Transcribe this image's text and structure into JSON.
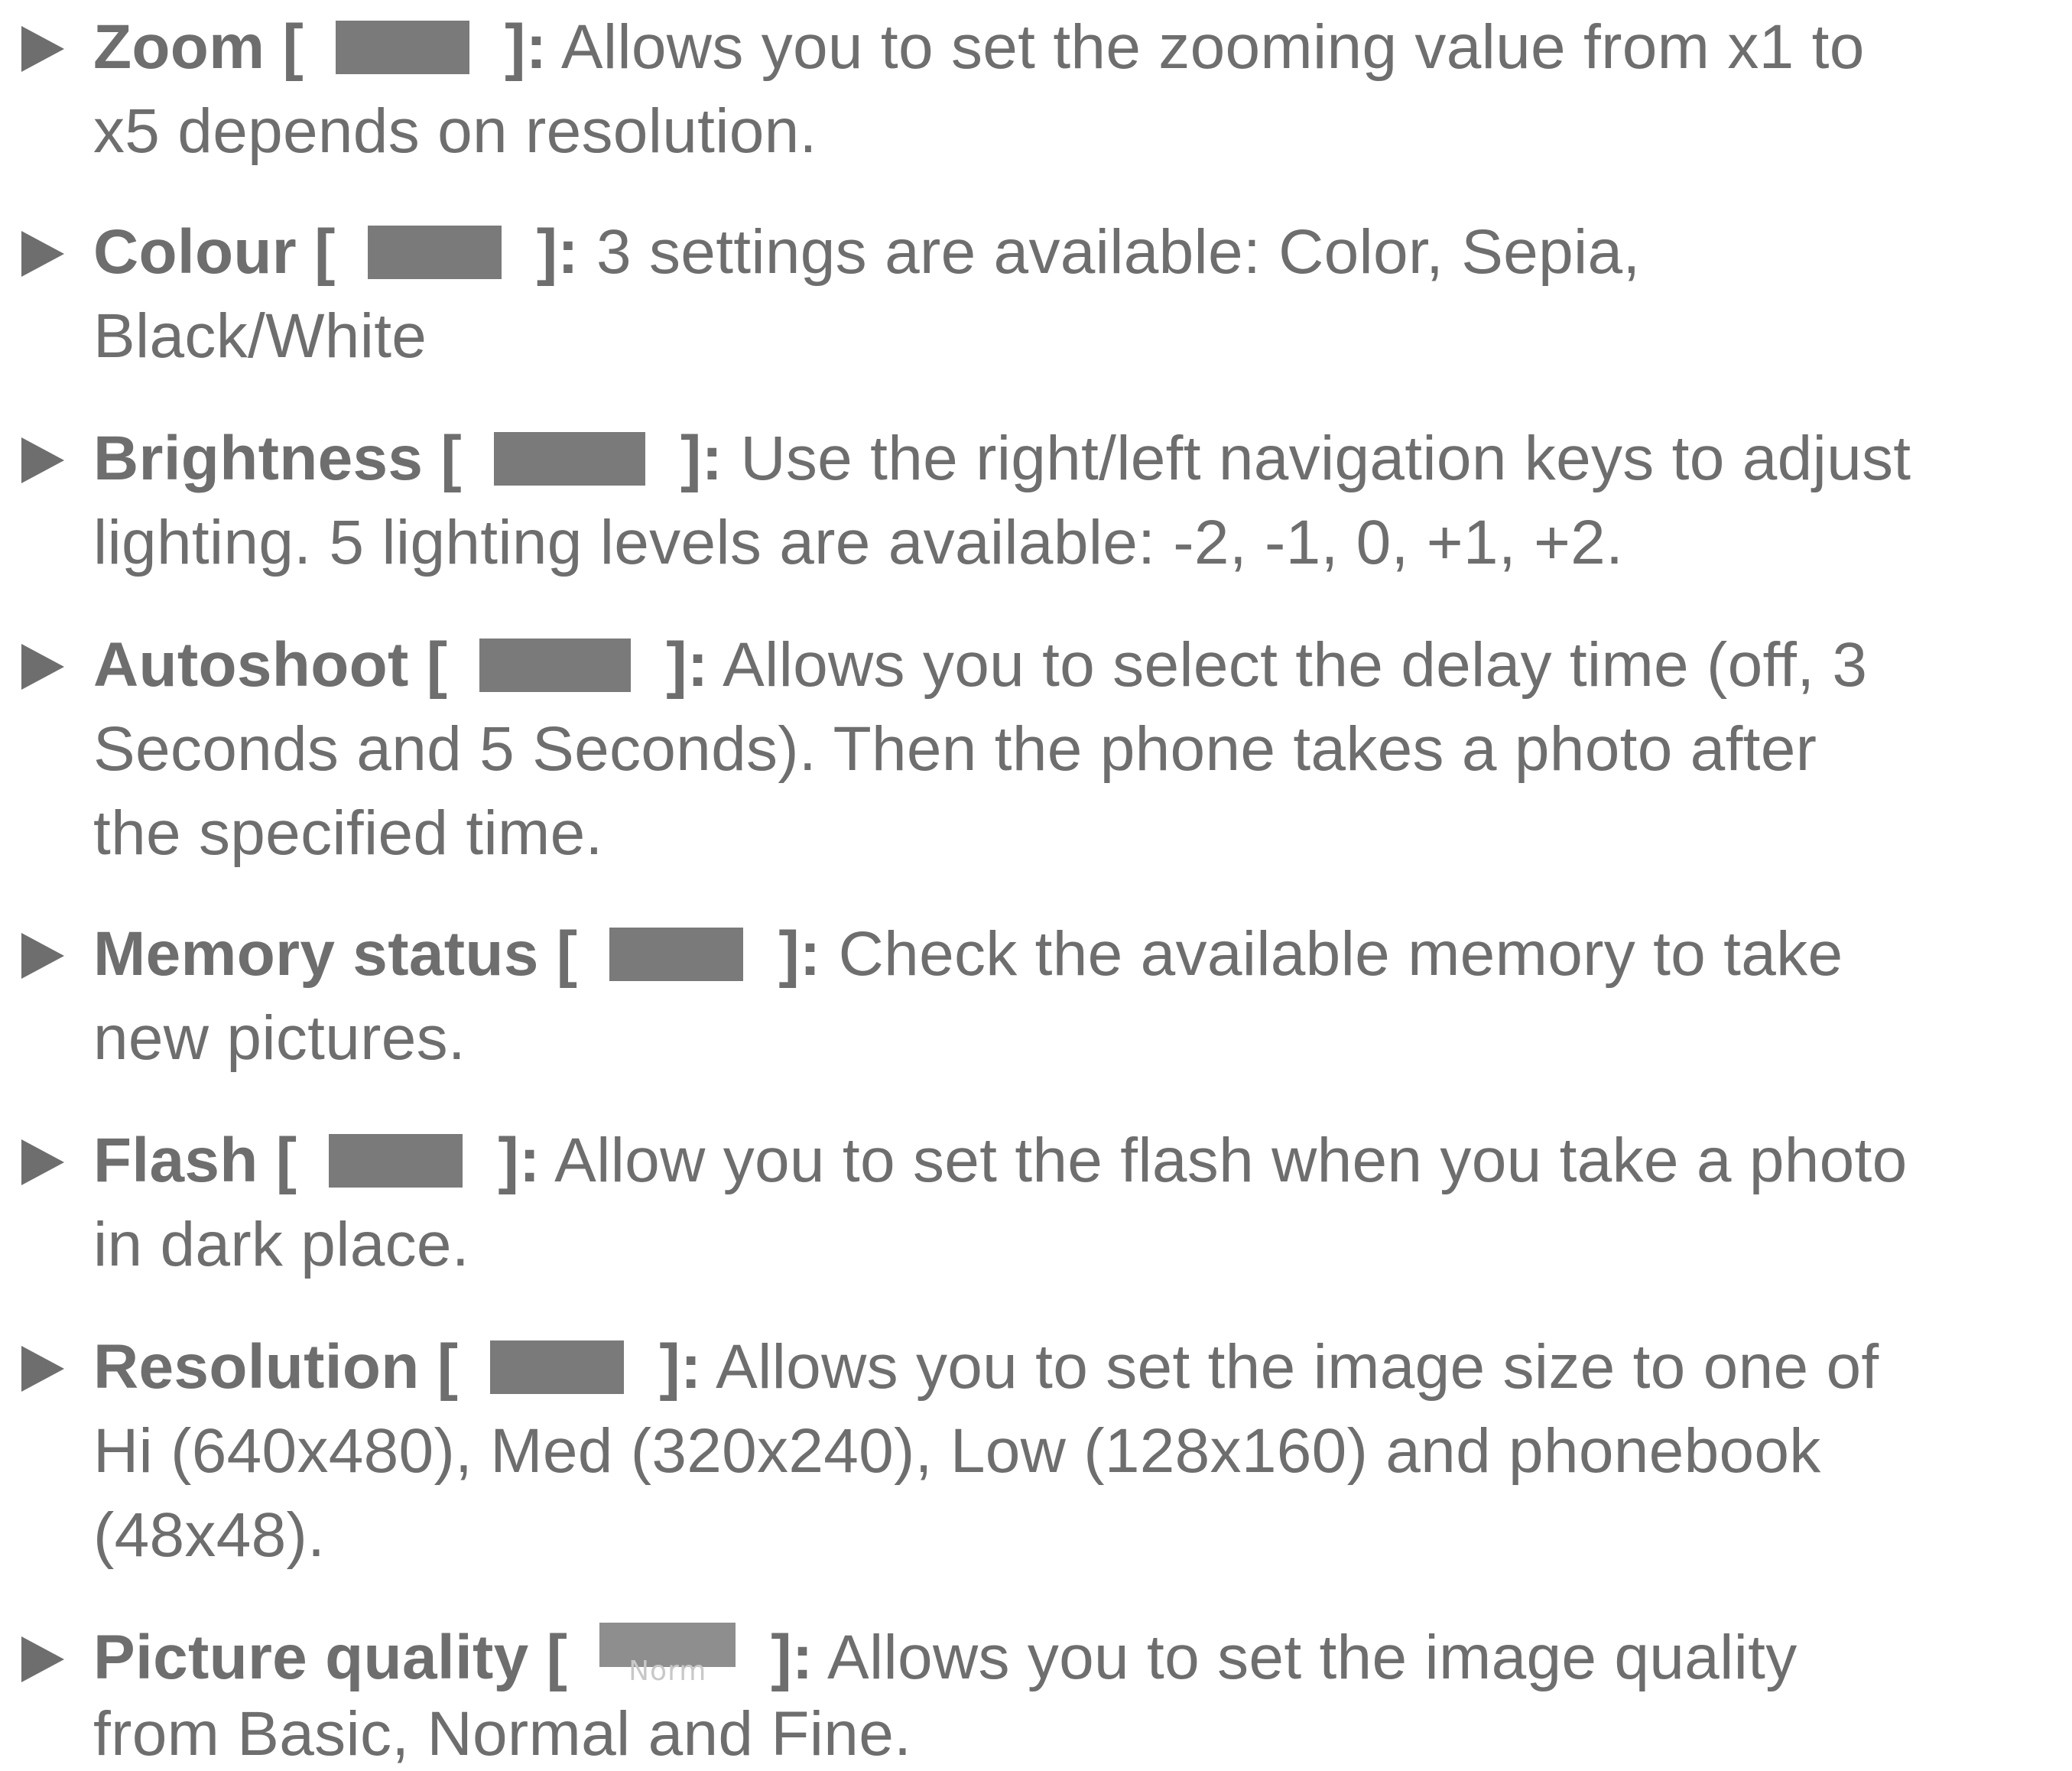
{
  "items": [
    {
      "title": "Zoom",
      "lines": [
        "Allows you to set the zooming value from x1 to",
        "x5 depends on resolution."
      ]
    },
    {
      "title": "Colour",
      "lines": [
        "3 settings are available: Color, Sepia,",
        "Black/White"
      ]
    },
    {
      "title": "Brightness",
      "lines": [
        "Use the right/left navigation keys to adjust",
        "lighting. 5 lighting levels are available: -2, -1, 0, +1, +2."
      ]
    },
    {
      "title": "Autoshoot",
      "lines": [
        "Allows you to select the delay time (off, 3",
        "Seconds and 5 Seconds). Then the phone takes a photo after",
        "the specified time."
      ]
    },
    {
      "title": "Memory status",
      "lines": [
        "Check the available memory to take",
        "new pictures."
      ]
    },
    {
      "title": "Flash",
      "lines": [
        "Allow you to set the flash when you take a photo",
        "in dark place."
      ]
    },
    {
      "title": "Resolution",
      "lines": [
        "Allows you to set the image size to one of",
        "Hi (640x480), Med (320x240), Low (128x160) and phonebook",
        "(48x48)."
      ]
    },
    {
      "title": "Picture quality",
      "icon_label": "Norm",
      "lines": [
        "Allows you to set the image quality",
        "from Basic, Normal and Fine."
      ]
    }
  ],
  "open_bracket": "[",
  "close_bracket": "]:"
}
